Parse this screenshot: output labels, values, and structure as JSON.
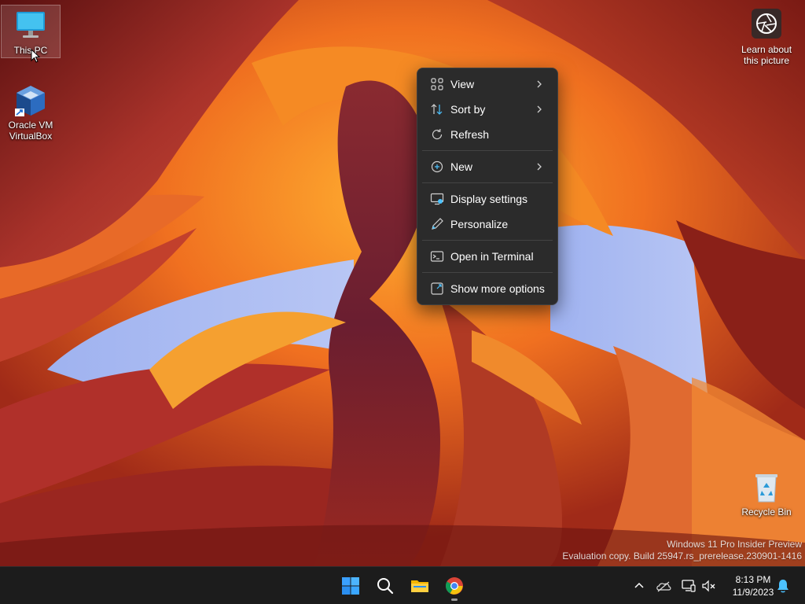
{
  "desktop": {
    "icons": [
      {
        "label": "This PC",
        "icon": "monitor-icon"
      },
      {
        "label": "Oracle VM VirtualBox",
        "label_line1": "Oracle VM",
        "label_line2": "VirtualBox",
        "icon": "virtualbox-icon"
      },
      {
        "label": "Recycle Bin",
        "icon": "recycle-bin-icon"
      }
    ],
    "learn_about": {
      "line1": "Learn about",
      "line2": "this picture",
      "icon": "camera-lens-icon"
    },
    "watermark": {
      "line1": "Windows 11 Pro Insider Preview",
      "line2": "Evaluation copy. Build 25947.rs_prerelease.230901-1416"
    }
  },
  "context_menu": {
    "items": [
      {
        "label": "View",
        "icon": "view-grid-icon",
        "submenu": true
      },
      {
        "label": "Sort by",
        "icon": "sort-icon",
        "submenu": true
      },
      {
        "label": "Refresh",
        "icon": "refresh-icon",
        "submenu": false
      },
      {
        "label": "New",
        "icon": "plus-circle-icon",
        "submenu": true
      },
      {
        "label": "Display settings",
        "icon": "display-icon",
        "submenu": false
      },
      {
        "label": "Personalize",
        "icon": "pen-icon",
        "submenu": false
      },
      {
        "label": "Open in Terminal",
        "icon": "terminal-icon",
        "submenu": false
      },
      {
        "label": "Show more options",
        "icon": "expand-icon",
        "submenu": false
      }
    ]
  },
  "taskbar": {
    "apps": [
      {
        "name": "Start",
        "icon": "windows-start-icon"
      },
      {
        "name": "Search",
        "icon": "search-icon"
      },
      {
        "name": "File Explorer",
        "icon": "folder-icon"
      },
      {
        "name": "Google Chrome",
        "icon": "chrome-icon"
      }
    ],
    "tray": {
      "icons": [
        "chevron-up-icon",
        "onedrive-icon",
        "network-icon",
        "volume-muted-icon",
        "notification-bell-icon"
      ],
      "time": "8:13 PM",
      "date": "11/9/2023"
    }
  },
  "colors": {
    "menu_bg": "#2b2b2b",
    "taskbar_bg": "#1c1c1c",
    "accent_blue": "#4cc2ff"
  }
}
